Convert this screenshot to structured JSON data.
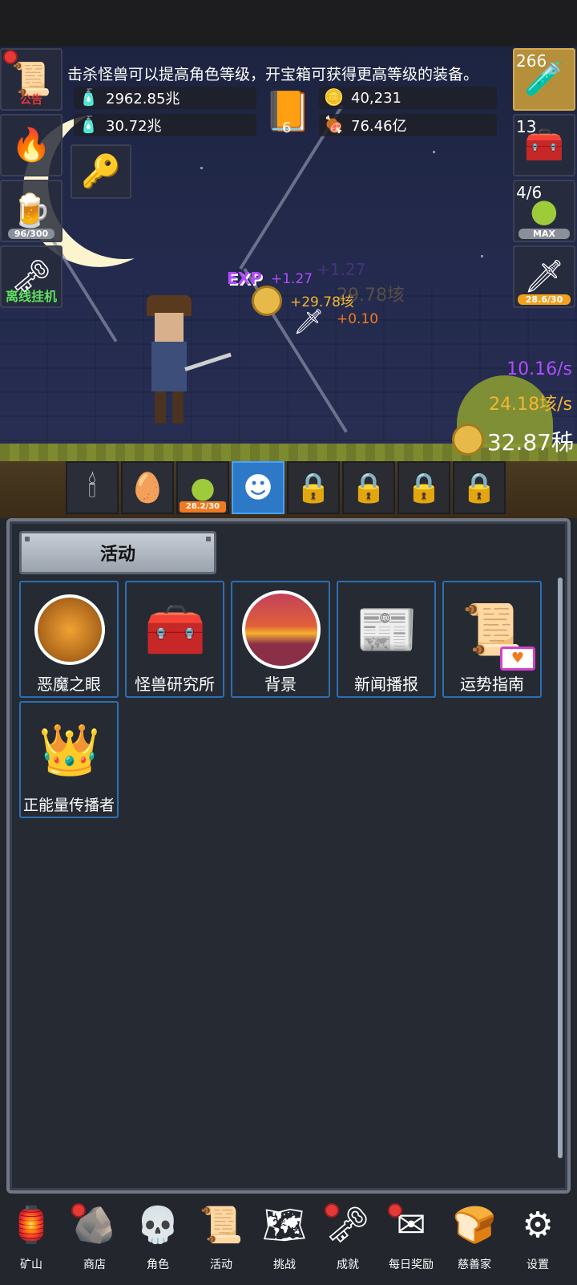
{
  "notice": "击杀怪兽可以提高角色等级，开宝箱可获得更高等级的装备。",
  "left_slots": [
    {
      "label": "公告",
      "icon": "scroll-icon"
    },
    {
      "label": "",
      "icon": "torch-icon"
    },
    {
      "label": "96/300",
      "icon": "beer-mug-icon"
    },
    {
      "label": "离线挂机",
      "icon": "key-icon"
    }
  ],
  "right_slots": [
    {
      "label": "266",
      "icon": "potion-icon"
    },
    {
      "label": "13",
      "icon": "chest-icon"
    },
    {
      "label": "4/6",
      "sub": "MAX",
      "icon": "slime-icon"
    },
    {
      "label": "28.6/30",
      "icon": "sword-icon"
    }
  ],
  "resources": {
    "blue_potion": "2962.85兆",
    "green_potion": "30.72兆",
    "book_count": "6",
    "silver_coin": "40,231",
    "meat": "76.46亿"
  },
  "floating": {
    "exp_tag": "EXP",
    "exp_gain": "+1.27",
    "exp_ghost": "+1.27",
    "gold_gain": "+29.78垓",
    "gold_ghost": "29.78垓",
    "dmg_gain": "+0.10"
  },
  "rates": {
    "exp_rate": "10.16/s",
    "gold_rate": "24.18垓/s",
    "gold_total": "32.87秭"
  },
  "pets": [
    {
      "icon": "candle-icon",
      "state": "normal"
    },
    {
      "icon": "egg-icon",
      "state": "normal"
    },
    {
      "icon": "slime-icon",
      "state": "normal",
      "progress": "28.2/30"
    },
    {
      "icon": "zombie-head-icon",
      "state": "selected"
    },
    {
      "icon": "lock-icon",
      "state": "locked"
    },
    {
      "icon": "lock-icon",
      "state": "locked"
    },
    {
      "icon": "lock-icon",
      "state": "locked"
    },
    {
      "icon": "lock-icon",
      "state": "locked"
    }
  ],
  "panel": {
    "title": "活动",
    "cards": [
      {
        "label": "恶魔之眼",
        "icon": "demon-eye-icon"
      },
      {
        "label": "怪兽研究所",
        "icon": "research-crate-icon"
      },
      {
        "label": "背景",
        "icon": "sunset-icon"
      },
      {
        "label": "新闻播报",
        "icon": "newspaper-icon"
      },
      {
        "label": "运势指南",
        "icon": "fortune-scroll-icon"
      },
      {
        "label": "正能量传播者",
        "icon": "crown-icon"
      }
    ]
  },
  "nav": [
    {
      "label": "矿山",
      "icon": "lantern-icon",
      "badge": false
    },
    {
      "label": "商店",
      "icon": "rock-icon",
      "badge": true
    },
    {
      "label": "角色",
      "icon": "skull-icon",
      "badge": false
    },
    {
      "label": "活动",
      "icon": "scroll-icon",
      "badge": false
    },
    {
      "label": "挑战",
      "icon": "map-icon",
      "badge": false
    },
    {
      "label": "成就",
      "icon": "key-icon",
      "badge": true
    },
    {
      "label": "每日奖励",
      "icon": "envelope-icon",
      "badge": true
    },
    {
      "label": "慈善家",
      "icon": "bread-icon",
      "badge": false
    },
    {
      "label": "设置",
      "icon": "gear-icon",
      "badge": false
    }
  ],
  "colors": {
    "exp": "#b04cff",
    "gold": "#f2b630",
    "damage": "#f07a1f",
    "offline": "#5ee05e",
    "selected": "#2d79c7"
  }
}
